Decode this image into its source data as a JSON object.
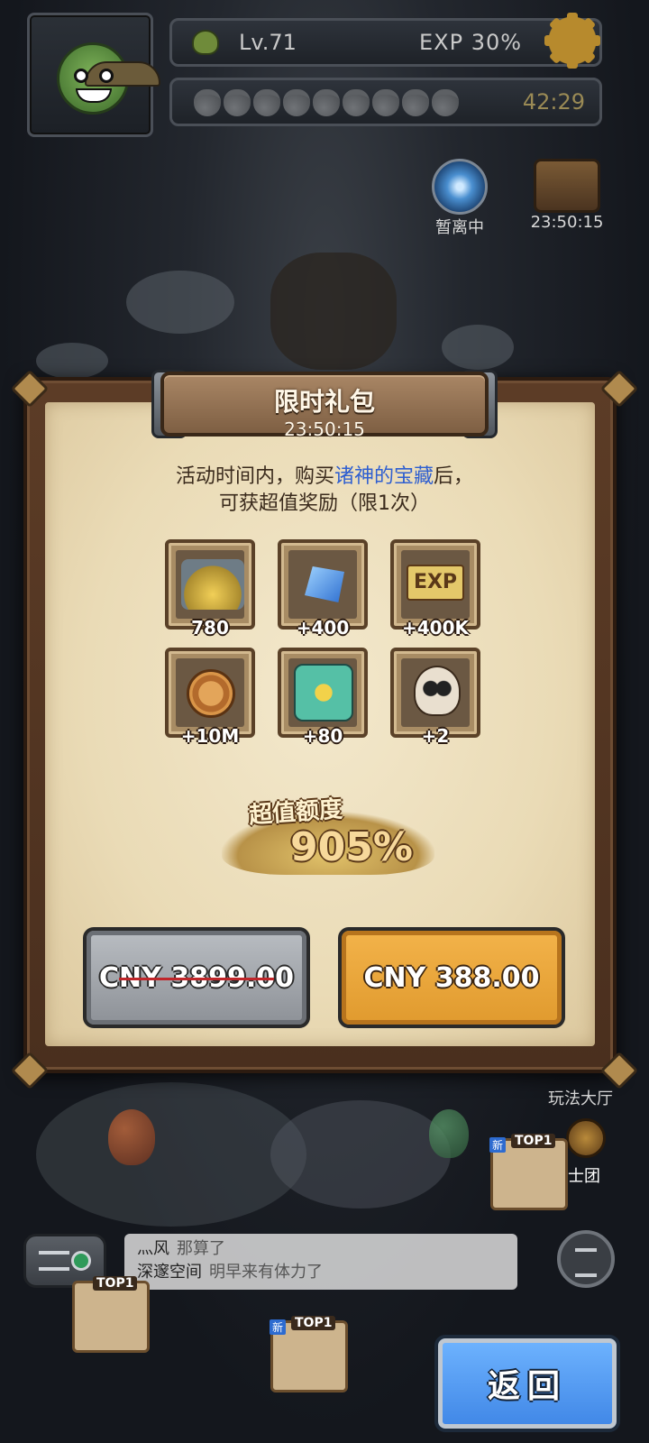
{
  "hud": {
    "level": "Lv.71",
    "exp": "EXP 30%",
    "stamina_timer": "42:29",
    "stamina_pips": 9
  },
  "side_icons": {
    "portal_label": "暂离中",
    "chest_timer": "23:50:15"
  },
  "dialog": {
    "title": "限时礼包",
    "timer": "23:50:15",
    "desc_pre": "活动时间内，购买",
    "desc_highlight": "诸神的宝藏",
    "desc_post": "后，",
    "desc_line2": "可获超值奖励（限1次）",
    "rewards": [
      {
        "icon": "treasure-chest-icon",
        "qty": "780"
      },
      {
        "icon": "blue-crystal-icon",
        "qty": "+400"
      },
      {
        "icon": "exp-icon",
        "qty": "+400K",
        "icon_text": "EXP"
      },
      {
        "icon": "gold-coin-icon",
        "qty": "+10M"
      },
      {
        "icon": "puzzle-piece-icon",
        "qty": "+80"
      },
      {
        "icon": "skull-icon",
        "qty": "+2"
      }
    ],
    "value_label": "超值额度",
    "value_percent": "905%",
    "original_price": "CNY 3899.00",
    "sale_price": "CNY 388.00"
  },
  "bottom": {
    "play_hall": "玩法大厅",
    "knights": "骑士团",
    "chat": [
      {
        "name": "灬风",
        "msg": "那算了"
      },
      {
        "name": "深邃空间",
        "msg": "明早来有体力了"
      }
    ],
    "top_tag": "TOP1",
    "new_tag": "新",
    "back": "返回"
  },
  "colors": {
    "highlight_blue": "#2f5fd0",
    "buy_orange": "#f3b34a",
    "back_blue": "#3f86e6",
    "strike_red": "#c0262a"
  }
}
